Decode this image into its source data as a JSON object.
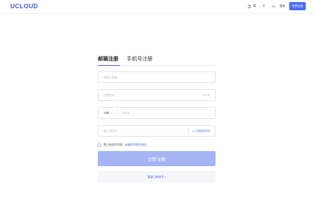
{
  "header": {
    "logo": "UCLOUD",
    "languages": [
      "简",
      "繁",
      "EN"
    ],
    "login": "登录",
    "free_signup": "免费注册"
  },
  "tabs": [
    {
      "label": "邮箱注册",
      "active": true
    },
    {
      "label": "手机号注册",
      "active": false
    }
  ],
  "fields": {
    "email_placeholder": "请输入邮箱",
    "password_placeholder": "设置密码",
    "country_code": "+86",
    "phone_placeholder": "手机号",
    "sms_placeholder": "输入验证码",
    "get_code": "获取验证码"
  },
  "agreement": {
    "text": "我已阅读并同意",
    "link": "云服务声明与协议"
  },
  "submit_label": "立即注册",
  "login_alt": "登录已有账号 ›",
  "colors": {
    "brand": "#3b5bdb",
    "button_primary": "#4a6cf7",
    "submit_disabled": "#a5b4f5"
  }
}
